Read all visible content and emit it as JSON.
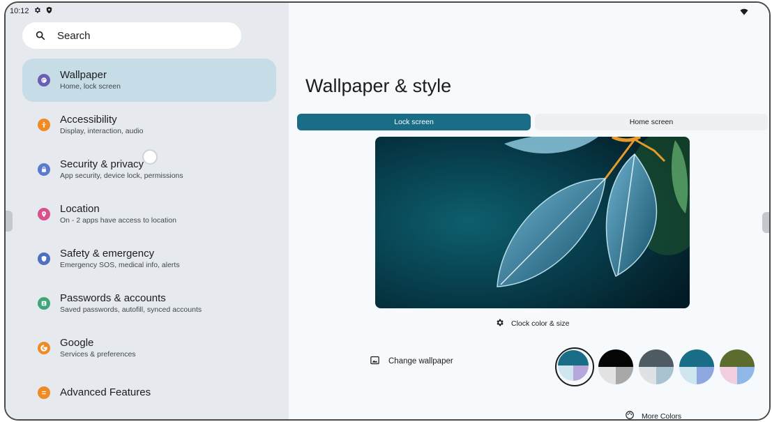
{
  "status_bar": {
    "time": "10:12",
    "icons": [
      "gear-icon",
      "shield-icon",
      "wifi-icon"
    ]
  },
  "search": {
    "label": "Search",
    "icon": "search-icon"
  },
  "sidebar": {
    "items": [
      {
        "title": "Wallpaper",
        "subtitle": "Home, lock screen",
        "icon": "palette-icon",
        "color": "#6b5fb5",
        "selected": true
      },
      {
        "title": "Accessibility",
        "subtitle": "Display, interaction, audio",
        "icon": "accessibility-icon",
        "color": "#f08a24"
      },
      {
        "title": "Security & privacy",
        "subtitle": "App security, device lock, permissions",
        "icon": "lock-icon",
        "color": "#5a7bd0"
      },
      {
        "title": "Location",
        "subtitle": "On - 2 apps have access to location",
        "icon": "location-pin-icon",
        "color": "#d8508e"
      },
      {
        "title": "Safety & emergency",
        "subtitle": "Emergency SOS, medical info, alerts",
        "icon": "shield-icon",
        "color": "#4f6fc0"
      },
      {
        "title": "Passwords & accounts",
        "subtitle": "Saved passwords, autofill, synced accounts",
        "icon": "account-box-icon",
        "color": "#3fa67a"
      },
      {
        "title": "Google",
        "subtitle": "Services & preferences",
        "icon": "google-icon",
        "color": "#f08a24"
      },
      {
        "title": "Advanced Features",
        "subtitle": "",
        "icon": "advanced-features-icon",
        "color": "#f08a24"
      }
    ]
  },
  "main": {
    "title": "Wallpaper & style",
    "tabs": [
      {
        "label": "Lock screen",
        "active": true
      },
      {
        "label": "Home screen",
        "active": false
      }
    ],
    "clock_label": "Clock color & size",
    "change_wallpaper_label": "Change wallpaper",
    "more_colors_label": "More Colors",
    "swatches": [
      {
        "top": "#1a6d87",
        "bl": "#cfe6f1",
        "br": "#b7a8dc",
        "selected": true
      },
      {
        "top": "#050505",
        "bl": "#e2e2e2",
        "br": "#a8a8a8",
        "selected": false
      },
      {
        "top": "#4f5b62",
        "bl": "#dfe2e5",
        "br": "#a8c2cf",
        "selected": false
      },
      {
        "top": "#1a6d87",
        "bl": "#cfe6f1",
        "br": "#8fa7e0",
        "selected": false
      },
      {
        "top": "#5c6b2e",
        "bl": "#f1cfe0",
        "br": "#8fb8e8",
        "selected": false
      }
    ]
  },
  "colors": {
    "accent": "#1a6d87",
    "selected_item_bg": "#c6dde8",
    "sidebar_bg": "#e6eaee"
  }
}
